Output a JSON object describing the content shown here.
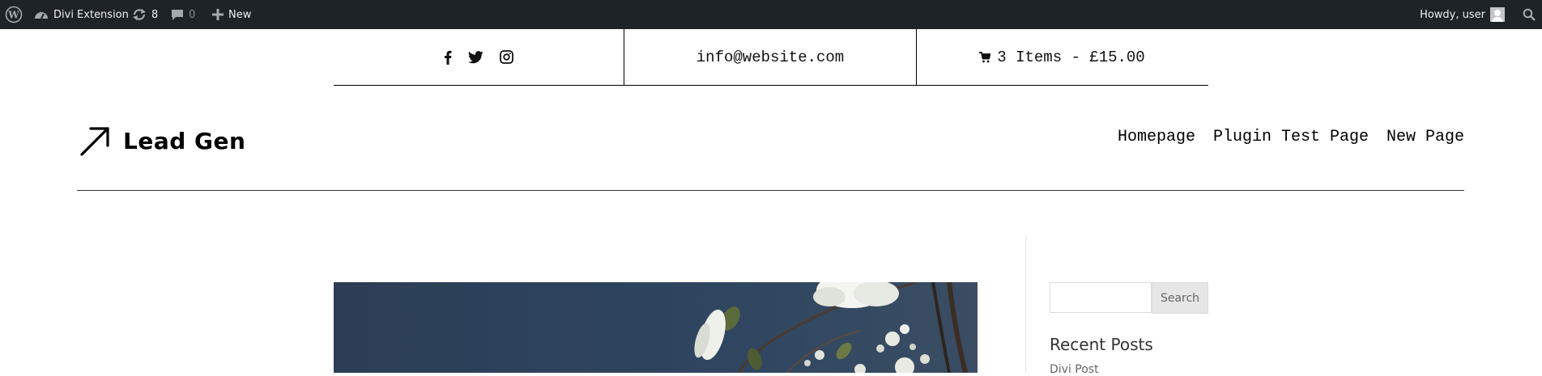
{
  "admin_bar": {
    "site_name": "Divi Extension",
    "updates_count": "8",
    "comments_count": "0",
    "new_label": "New",
    "howdy": "Howdy, user"
  },
  "top_header": {
    "email": "info@website.com",
    "cart": "3 Items - £15.00",
    "social_icons": [
      "facebook-icon",
      "twitter-icon",
      "instagram-icon"
    ]
  },
  "header": {
    "logo_text": "Lead Gen",
    "nav": [
      "Homepage",
      "Plugin Test Page",
      "New Page"
    ]
  },
  "sidebar": {
    "search_button": "Search",
    "search_placeholder": "",
    "recent_posts_title": "Recent Posts",
    "recent_posts": [
      "Divi Post"
    ]
  },
  "colors": {
    "admin_bar_bg": "#1d2327",
    "hero_bg": "#2c3f55"
  }
}
